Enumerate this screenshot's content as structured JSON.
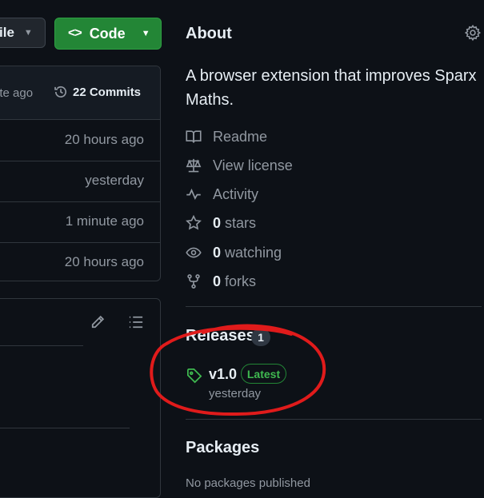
{
  "toolbar": {
    "file_label": "ile",
    "code_label": "Code"
  },
  "files_panel": {
    "latest_commit_time": "ute ago",
    "commits_label": "22 Commits",
    "rows": [
      {
        "time": "20 hours ago"
      },
      {
        "time": "yesterday"
      },
      {
        "time": "1 minute ago"
      },
      {
        "time": "20 hours ago"
      }
    ]
  },
  "about": {
    "title": "About",
    "description": "A browser extension that improves Sparx Maths.",
    "readme": "Readme",
    "license": "View license",
    "activity": "Activity",
    "stars_count": "0",
    "stars_label": "stars",
    "watching_count": "0",
    "watching_label": "watching",
    "forks_count": "0",
    "forks_label": "forks"
  },
  "releases": {
    "title": "Releases",
    "count": "1",
    "latest_name": "v1.0",
    "latest_badge": "Latest",
    "latest_date": "yesterday"
  },
  "packages": {
    "title": "Packages",
    "note": "No packages published"
  },
  "colors": {
    "background": "#0d1117",
    "accent_green": "#238636",
    "annotation_red": "#e01b1b"
  }
}
